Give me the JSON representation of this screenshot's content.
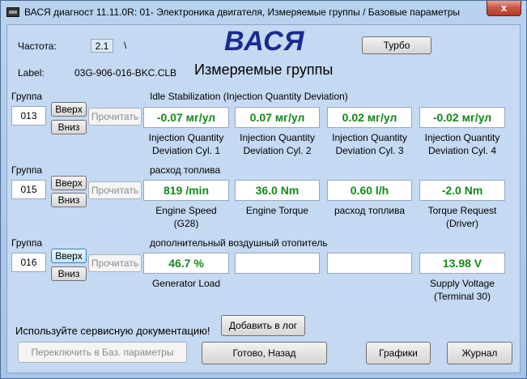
{
  "window": {
    "title": "ВАСЯ диагност 11.11.0R: 01- Электроника двигателя,  Измеряемые группы / Базовые параметры",
    "close": "x"
  },
  "header": {
    "freq_label": "Частота:",
    "freq_value": "2.1",
    "freq_sep": "\\",
    "app_name": "ВАСЯ",
    "turbo_button": "Турбо",
    "label_caption": "Label:",
    "label_value": "03G-906-016-BKC.CLB",
    "section_title": "Измеряемые группы"
  },
  "common": {
    "group_caption": "Группа",
    "up": "Вверх",
    "down": "Вниз",
    "read": "Прочитать"
  },
  "groups": [
    {
      "number": "013",
      "title": "Idle Stabilization (Injection Quantity Deviation)",
      "fields": [
        {
          "value": "-0.07 мг/ул",
          "label1": "Injection Quantity",
          "label2": "Deviation Cyl. 1"
        },
        {
          "value": "0.07 мг/ул",
          "label1": "Injection Quantity",
          "label2": "Deviation Cyl. 2"
        },
        {
          "value": "0.02 мг/ул",
          "label1": "Injection Quantity",
          "label2": "Deviation Cyl. 3"
        },
        {
          "value": "-0.02 мг/ул",
          "label1": "Injection Quantity",
          "label2": "Deviation Cyl. 4"
        }
      ]
    },
    {
      "number": "015",
      "title": "расход топлива",
      "fields": [
        {
          "value": "819 /min",
          "label1": "Engine Speed",
          "label2": "(G28)"
        },
        {
          "value": "36.0 Nm",
          "label1": "Engine Torque",
          "label2": ""
        },
        {
          "value": "0.60 l/h",
          "label1": "расход топлива",
          "label2": ""
        },
        {
          "value": "-2.0 Nm",
          "label1": "Torque Request",
          "label2": "(Driver)"
        }
      ]
    },
    {
      "number": "016",
      "title": "дополнительный воздушный отопитель",
      "fields": [
        {
          "value": "46.7 %",
          "label1": "Generator Load",
          "label2": ""
        },
        {
          "value": "",
          "label1": "",
          "label2": ""
        },
        {
          "value": "",
          "label1": "",
          "label2": ""
        },
        {
          "value": "13.98 V",
          "label1": "Supply Voltage",
          "label2": "(Terminal 30)"
        }
      ]
    }
  ],
  "footer": {
    "service_note": "Используйте сервисную документацию!",
    "add_log": "Добавить в лог",
    "switch_basic": "Переключить в Баз. параметры",
    "done_back": "Готово, Назад",
    "graphs": "Графики",
    "journal": "Журнал"
  },
  "colors": {
    "value_green": "#128a18",
    "app_name_blue": "#1b2a8f",
    "background": "#c5d9f3"
  }
}
